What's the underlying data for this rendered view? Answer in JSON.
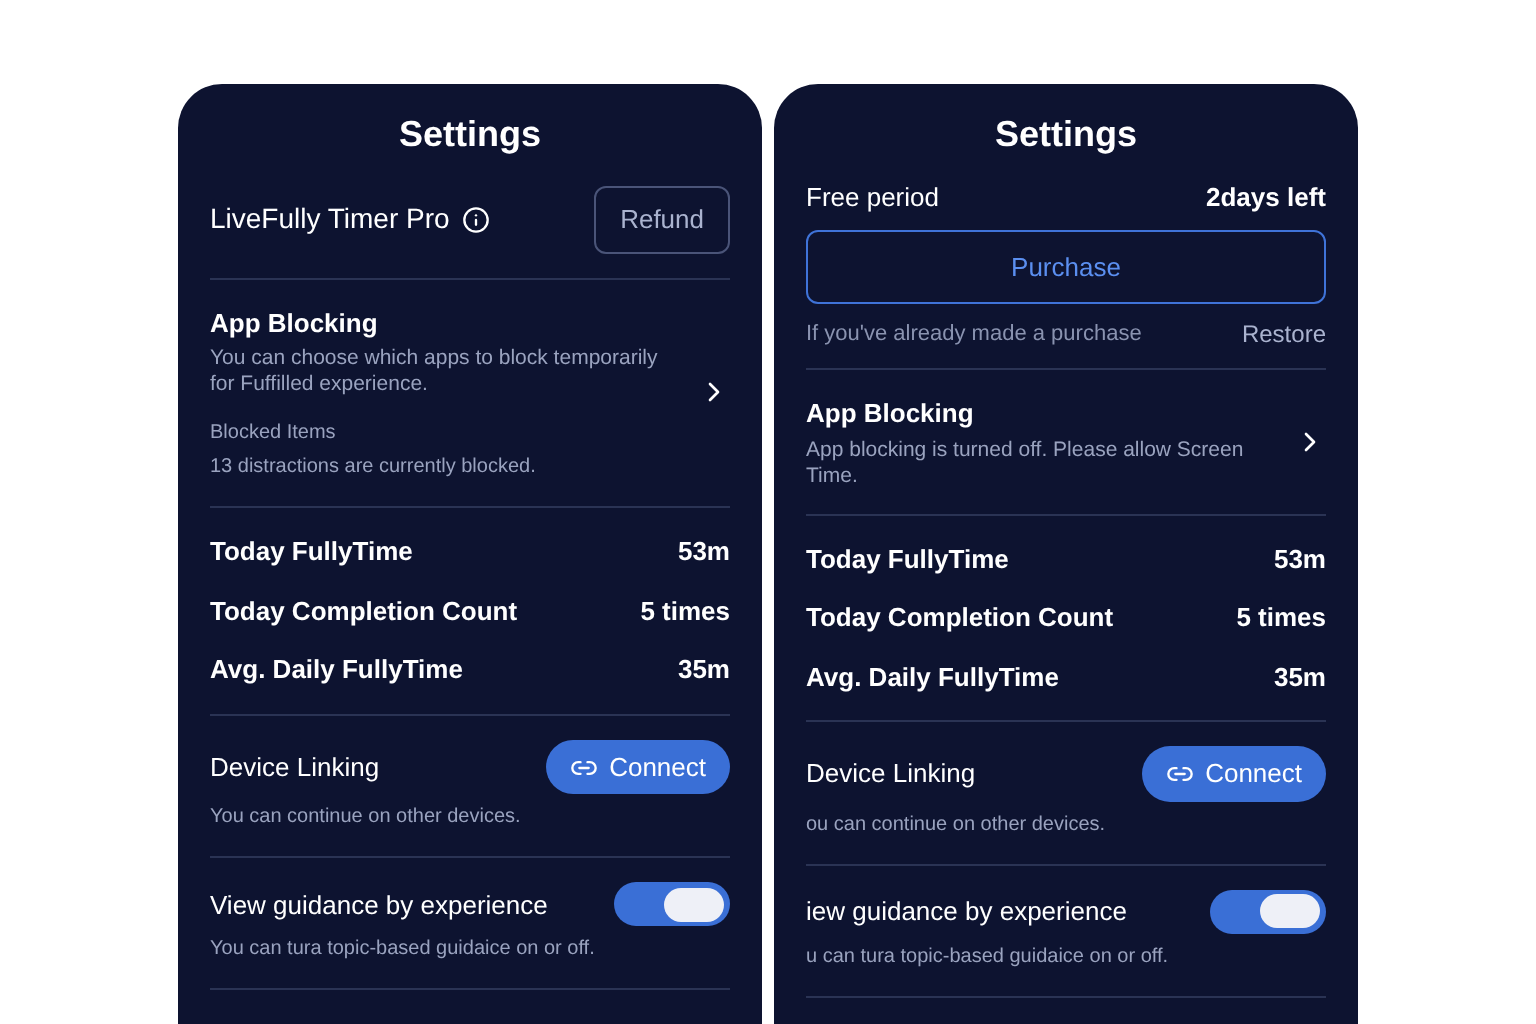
{
  "panels": [
    {
      "title": "Settings",
      "sections": [
        {
          "kind": "pro",
          "name": "LiveFully Timer Pro",
          "button": "Refund"
        },
        {
          "kind": "blocking",
          "title": "App Blocking",
          "description": "You can choose which apps to block temporarily for Fuffilled experience.",
          "blocked_label": "Blocked Items",
          "blocked_text": "13 distractions are currently blocked."
        },
        {
          "kind": "stats",
          "rows": [
            {
              "label": "Today FullyTime",
              "value": "53m"
            },
            {
              "label": "Today Completion Count",
              "value": "5 times"
            },
            {
              "label": "Avg. Daily FullyTime",
              "value": "35m"
            }
          ]
        },
        {
          "kind": "link",
          "title": "Device Linking",
          "description": "You can continue on other devices.",
          "button": "Connect"
        },
        {
          "kind": "toggle",
          "title": "View guidance by experience",
          "description": "You can tura topic-based guidaice on or off.",
          "on": true
        }
      ]
    },
    {
      "title": "Settings",
      "sections": [
        {
          "kind": "trial",
          "label": "Free period",
          "remaining": "2days left",
          "button": "Purchase",
          "note": "If you've already made a purchase",
          "link": "Restore"
        },
        {
          "kind": "blocking",
          "title": "App Blocking",
          "description": "App blocking is turned off. Please allow Screen Time."
        },
        {
          "kind": "stats",
          "rows": [
            {
              "label": "Today FullyTime",
              "value": "53m"
            },
            {
              "label": "Today Completion Count",
              "value": "5 times"
            },
            {
              "label": "Avg. Daily FullyTime",
              "value": "35m"
            }
          ]
        },
        {
          "kind": "link",
          "title": "Device Linking",
          "description": "ou can continue on other devices.",
          "button": "Connect"
        },
        {
          "kind": "toggle",
          "title": "iew guidance by experience",
          "description": "u can tura topic-based guidaice on or off.",
          "on": true
        }
      ]
    }
  ]
}
